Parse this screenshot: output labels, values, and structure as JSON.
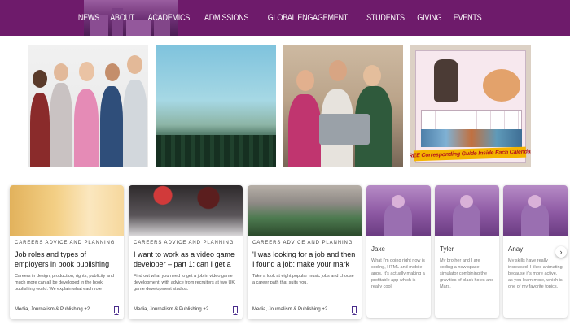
{
  "header": {
    "nav": [
      "NEWS",
      "ABOUT",
      "ACADEMICS",
      "ADMISSIONS",
      "GLOBAL ENGAGEMENT",
      "STUDENTS",
      "GIVING",
      "EVENTS"
    ]
  },
  "photos": {
    "calendar_banner": "FREE Corresponding Guide Inside Each Calendar!"
  },
  "cards": [
    {
      "tag": "CAREERS ADVICE AND PLANNING",
      "title": "Job roles and types of employers in book publishing",
      "desc": "Careers in design, production, rights, publicity and much more can all be developed in the book publishing world. We explain what each role involves...",
      "meta": "Media, Journalism & Publishing +2"
    },
    {
      "tag": "CAREERS ADVICE AND PLANNING",
      "title": "I want to work as a video game developer – part 1: can I get a job i...",
      "desc": "Find out what you need to get a job in video game development, with advice from recruiters at two UK game development studios.",
      "meta": "Media, Journalism & Publishing +2"
    },
    {
      "tag": "CAREERS ADVICE AND PLANNING",
      "title": "'I was looking for a job and then I found a job: make your mark on...",
      "desc": "Take a look at eight popular music jobs and choose a career path that suits you.",
      "meta": "Media, Journalism & Publishing +2"
    }
  ],
  "people": [
    {
      "name": "Jaxe",
      "desc": "What I'm doing right now is coding, HTML and mobile apps. It's actually making a profitable app which is really cool."
    },
    {
      "name": "Tyler",
      "desc": "My brother and I are coding a new space simulator combining the gravities of black holes and Mars."
    },
    {
      "name": "Anay",
      "desc": "My skills have really increased. I liked animating because it's more active, as you learn more, which is one of my favorite topics."
    }
  ],
  "controls": {
    "next": "›"
  },
  "colors": {
    "header_bg": "#6e1b6b",
    "accent": "#4a2c8c"
  }
}
